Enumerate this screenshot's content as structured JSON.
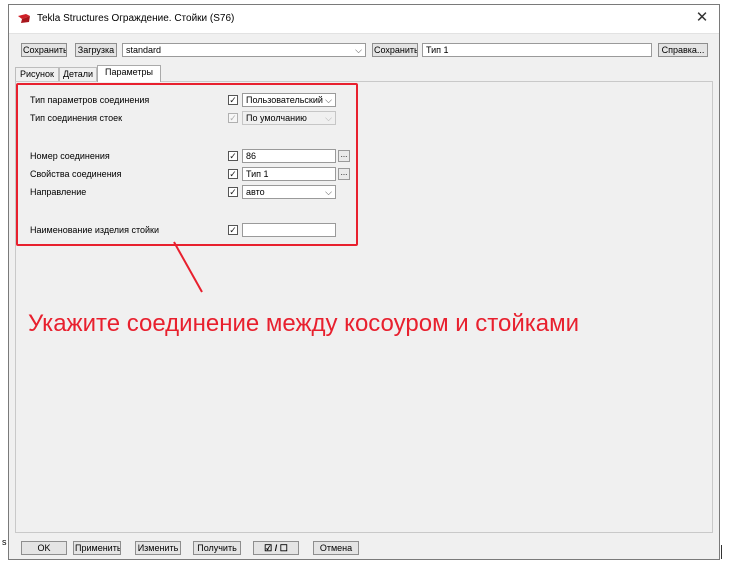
{
  "window": {
    "title": "Tekla Structures  Ограждение. Стойки (S76)",
    "close_glyph": "✕"
  },
  "toolbar": {
    "save_label": "Сохранить",
    "load_label": "Загрузка",
    "preset_value": "standard",
    "save_as_label": "Сохранить как",
    "save_as_name": "Тип 1",
    "help_label": "Справка..."
  },
  "tabs": [
    {
      "label": "Рисунок",
      "active": false
    },
    {
      "label": "Детали",
      "active": false
    },
    {
      "label": "Параметры",
      "active": true
    }
  ],
  "params": {
    "rows": [
      {
        "label": "Тип параметров соединения",
        "checked": true,
        "control": "select",
        "value": "Пользовательский"
      },
      {
        "label": "Тип соединения стоек",
        "checked": true,
        "disabled": true,
        "control": "select",
        "value": "По умолчанию"
      },
      {
        "label": "Номер соединения",
        "checked": true,
        "control": "input-dots",
        "value": "86"
      },
      {
        "label": "Свойства соединения",
        "checked": true,
        "control": "input-dots",
        "value": "Тип 1"
      },
      {
        "label": "Направление",
        "checked": true,
        "control": "select",
        "value": "авто"
      },
      {
        "label": "Наименование изделия стойки",
        "checked": true,
        "control": "input",
        "value": ""
      }
    ]
  },
  "annotation": {
    "text": "Укажите соединение между косоуром и стойками",
    "color": "#e8202e"
  },
  "bottom": {
    "ok_label": "OK",
    "apply_label": "Применить",
    "modify_label": "Изменить",
    "get_label": "Получить",
    "toggle_label": "☑ / ☐",
    "cancel_label": "Отмена",
    "left_fragment": "s"
  }
}
